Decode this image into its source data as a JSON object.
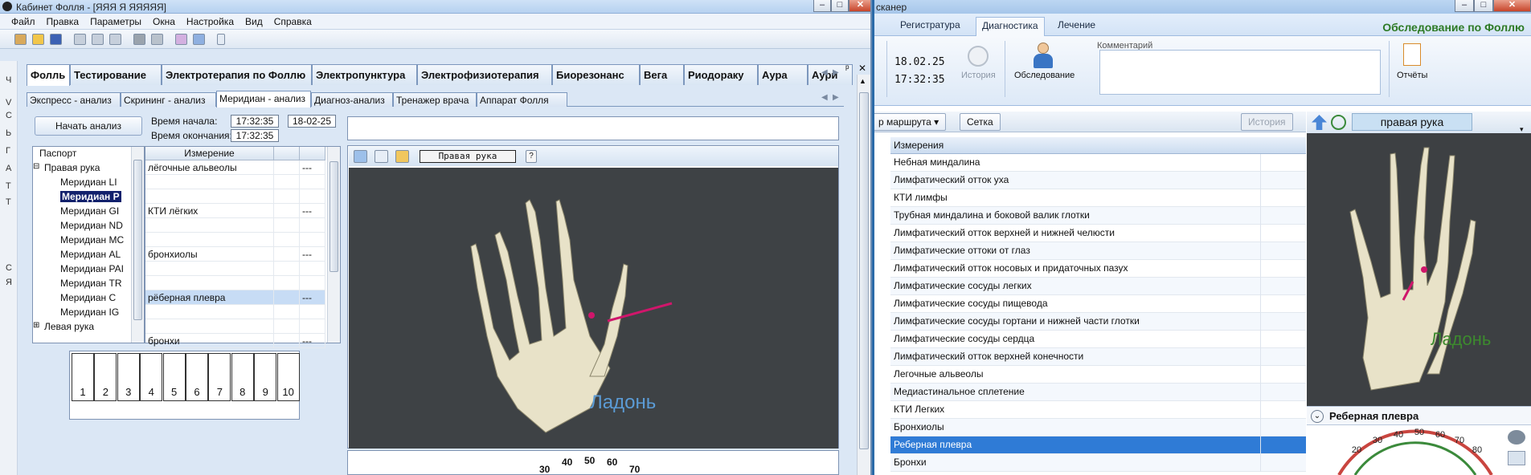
{
  "left_window": {
    "title": "Кабинет Фолля - [ЯЯЯ Я ЯЯЯЯЯ]",
    "menu": [
      "Файл",
      "Правка",
      "Параметры",
      "Окна",
      "Настройка",
      "Вид",
      "Справка"
    ],
    "side_letters": [
      "Ч",
      "V",
      "С",
      "Ь",
      "Г",
      "А",
      "Т",
      "Т",
      "С",
      "Я"
    ],
    "main_tabs": [
      "Фолль",
      "Тестирование",
      "Электротерапия по Фоллю",
      "Электропунктура",
      "Электрофизиотерапия",
      "Биорезонанс",
      "Вега",
      "Риодораку",
      "Аура",
      "Аури"
    ],
    "sub_tabs": [
      "Экспресс - анализ",
      "Скрининг - анализ",
      "Меридиан - анализ",
      "Диагноз-анализ",
      "Тренажер врача",
      "Аппарат Фолля"
    ],
    "start_button": "Начать анализ",
    "start_time_label": "Время начала:",
    "start_time": "17:32:35",
    "start_date": "18-02-25",
    "end_time_label": "Время окончания:",
    "end_time": "17:32:35",
    "tree": [
      {
        "label": "Паспорт",
        "indent": 0
      },
      {
        "label": "Правая рука",
        "indent": 0,
        "expander": "⊟"
      },
      {
        "label": "Меридиан LI",
        "indent": 1
      },
      {
        "label": "Меридиан Р",
        "indent": 1,
        "selected": true
      },
      {
        "label": "Меридиан GI",
        "indent": 1
      },
      {
        "label": "Меридиан ND",
        "indent": 1
      },
      {
        "label": "Меридиан МС",
        "indent": 1
      },
      {
        "label": "Меридиан AL",
        "indent": 1
      },
      {
        "label": "Меридиан PAI",
        "indent": 1
      },
      {
        "label": "Меридиан TR",
        "indent": 1
      },
      {
        "label": "Меридиан С",
        "indent": 1
      },
      {
        "label": "Меридиан IG",
        "indent": 1
      },
      {
        "label": "Левая рука",
        "indent": 0,
        "expander": "⊞"
      }
    ],
    "measure_header": "Измерение",
    "measures": [
      {
        "name": "лёгочные альвеолы",
        "value": "---"
      },
      {
        "name": "",
        "value": ""
      },
      {
        "name": "",
        "value": ""
      },
      {
        "name": "КТИ лёгких",
        "value": "---"
      },
      {
        "name": "",
        "value": ""
      },
      {
        "name": "",
        "value": ""
      },
      {
        "name": "бронхиолы",
        "value": "---"
      },
      {
        "name": "",
        "value": ""
      },
      {
        "name": "",
        "value": ""
      },
      {
        "name": "рёберная плевра",
        "value": "---",
        "selected": true
      },
      {
        "name": "",
        "value": ""
      },
      {
        "name": "",
        "value": ""
      },
      {
        "name": "бронхи",
        "value": "---"
      }
    ],
    "number_cells": [
      "1",
      "2",
      "3",
      "4",
      "5",
      "6",
      "7",
      "8",
      "9",
      "10"
    ],
    "viewer_label": "Правая рука",
    "viewer_caption": "Ладонь",
    "gauge_ticks": [
      "30",
      "40",
      "50",
      "60",
      "70"
    ]
  },
  "right_window": {
    "title": "сканер",
    "ribbon_tabs": [
      "Регистратура",
      "Диагностика",
      "Лечение"
    ],
    "ribbon_title": "Обследование по Фоллю",
    "date": "18.02.25",
    "time": "17:32:35",
    "history_label": "История",
    "exam_label": "Обследование",
    "comment_label": "Комментарий",
    "reports_label": "Отчёты",
    "route_button": "р маршрута ▾",
    "grid_button": "Сетка",
    "history_button": "История",
    "list_header": "Измерения",
    "items": [
      "Небная миндалина",
      "Лимфатический отток уха",
      "КТИ лимфы",
      "Трубная миндалина и боковой валик глотки",
      "Лимфатический отток верхней и нижней челюсти",
      "Лимфатические оттоки от глаз",
      "Лимфатический отток носовых и придаточных пазух",
      "Лимфатические сосуды легких",
      "Лимфатические сосуды пищевода",
      "Лимфатические сосуды гортани и нижней части глотки",
      "Лимфатические сосуды сердца",
      "Лимфатический отток верхней конечности",
      "Легочные альвеолы",
      "Медиастинальное сплетение",
      "КТИ Легких",
      "Бронхиолы",
      "Реберная плевра",
      "Бронхи"
    ],
    "selected_item": 16,
    "view_label": "правая рука",
    "view_caption": "Ладонь",
    "section_title": "Реберная плевра",
    "gauge_ticks": [
      "20",
      "30",
      "40",
      "50",
      "60",
      "70",
      "80"
    ]
  },
  "colors": {
    "accent_selected": "#2f7bd6",
    "tree_selected": "#12216c",
    "caption_blue": "#5b9bd5",
    "caption_green": "#3d8a2e",
    "marker": "#d0166b"
  }
}
